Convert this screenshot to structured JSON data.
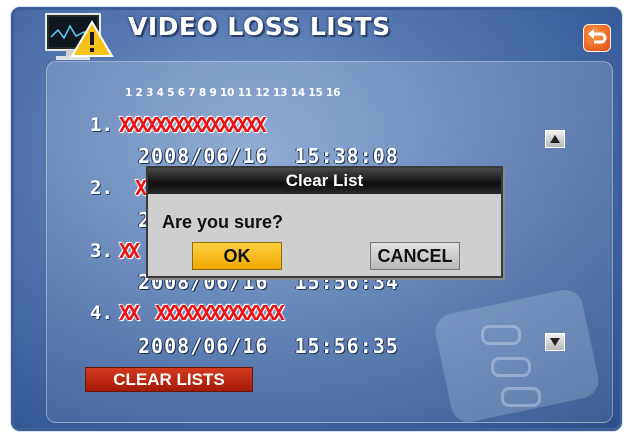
{
  "window": {
    "title": "VIDEO LOSS LISTS"
  },
  "channel_header": "1 2 3 4 5 6 7 8 9 10 11 12 13 14 15 16",
  "rows": [
    {
      "num": "1.",
      "channels": "XXXXXXXXXXXXXXXX",
      "datetime": "2008/06/16  15:38:08"
    },
    {
      "num": "2.",
      "channels": "X",
      "datetime": "2"
    },
    {
      "num": "3.",
      "channels": "XX",
      "datetime": "2008/06/16  15:56:34"
    },
    {
      "num": "4.",
      "channels": "XX  XXXXXXXXXXXXXX",
      "datetime": "2008/06/16  15:56:35"
    }
  ],
  "buttons": {
    "clear_lists": "CLEAR LISTS"
  },
  "dialog": {
    "title": "Clear List",
    "message": "Are you sure?",
    "ok": "OK",
    "cancel": "CANCEL"
  },
  "icons": {
    "monitor_warning": "monitor-warning-icon",
    "back": "back-arrow-icon",
    "scroll_up": "scroll-up-icon",
    "scroll_down": "scroll-down-icon"
  },
  "colors": {
    "background": "#4b6ea8",
    "channel_lost": "#ee1010",
    "clear_button": "#c02a12",
    "ok_button": "#f5b800",
    "dialog_title_bar": "#111111"
  }
}
